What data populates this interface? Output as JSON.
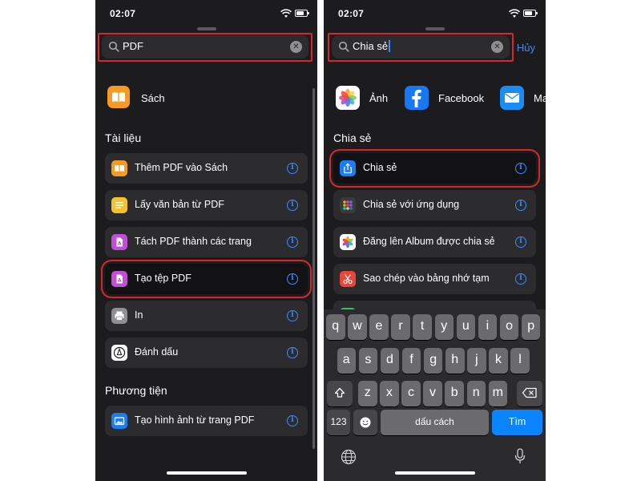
{
  "left": {
    "status_time": "02:07",
    "search_query": "PDF",
    "top_app": {
      "label": "Sách",
      "icon": "books-icon"
    },
    "sections": [
      {
        "title": "Tài liệu"
      },
      {
        "title": "Phương tiện"
      }
    ],
    "rows": [
      {
        "label": "Thêm PDF vào Sách",
        "icon": "books-icon",
        "color": "#f59b24"
      },
      {
        "label": "Lấy văn bản từ PDF",
        "icon": "notes-icon",
        "color": "#f4c32a"
      },
      {
        "label": "Tách PDF thành các trang",
        "icon": "pdf-file-icon",
        "color": "#c34fd8"
      },
      {
        "label": "Tạo tệp PDF",
        "icon": "pdf-file-icon",
        "color": "#c34fd8"
      },
      {
        "label": "In",
        "icon": "printer-icon",
        "color": "#8e8e93"
      },
      {
        "label": "Đánh dấu",
        "icon": "markup-pen-icon",
        "color": "#ffffff"
      },
      {
        "label": "Tạo hình ảnh từ trang PDF",
        "icon": "images-icon",
        "color": "#1e7cf2"
      }
    ]
  },
  "right": {
    "status_time": "02:07",
    "search_query": "Chia sẻ",
    "cancel_label": "Hủy",
    "apps": [
      {
        "label": "Ảnh",
        "icon": "photos-icon"
      },
      {
        "label": "Facebook",
        "icon": "facebook-icon"
      },
      {
        "label": "Ma",
        "icon": "mail-icon"
      }
    ],
    "section_title": "Chia sẻ",
    "rows": [
      {
        "label": "Chia sẻ",
        "icon": "share-icon",
        "color": "#1e7cf2"
      },
      {
        "label": "Chia sẻ với ứng dụng",
        "icon": "app-grid-icon",
        "color": "#3a3a3c"
      },
      {
        "label": "Đăng lên Album được chia sẻ",
        "icon": "photos-icon",
        "color": "#ffffff"
      },
      {
        "label": "Sao chép vào bảng nhớ tạm",
        "icon": "scissors-icon",
        "color": "#e9453a"
      }
    ],
    "keyboard": {
      "row1": [
        "q",
        "w",
        "e",
        "r",
        "t",
        "y",
        "u",
        "i",
        "o",
        "p"
      ],
      "row2": [
        "a",
        "s",
        "d",
        "f",
        "g",
        "h",
        "j",
        "k",
        "l"
      ],
      "row3": [
        "z",
        "x",
        "c",
        "v",
        "b",
        "n",
        "m"
      ],
      "num_label": "123",
      "space_label": "dấu cách",
      "go_label": "Tìm"
    }
  }
}
